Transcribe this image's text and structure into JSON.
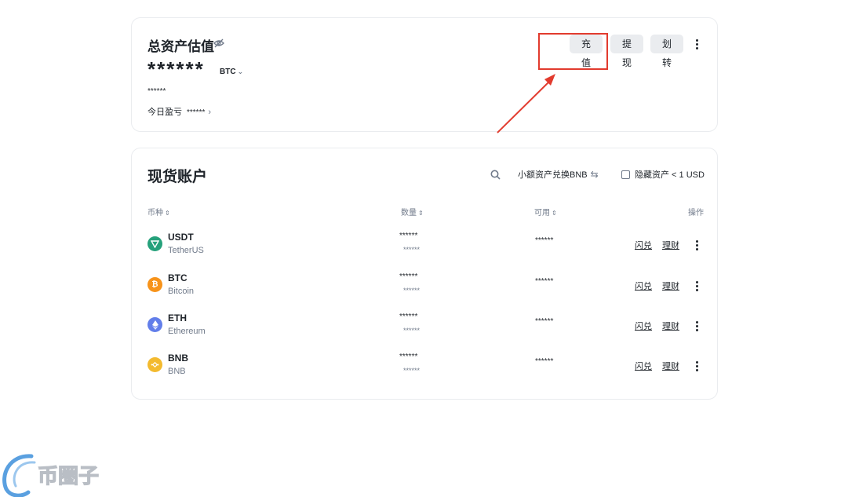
{
  "asset_card": {
    "title": "总资产估值",
    "balance": "******",
    "unit": "BTC",
    "sub_balance": "******",
    "pnl_label": "今日盈亏",
    "pnl_value": "******",
    "buttons": {
      "deposit": "充值",
      "withdraw": "提现",
      "transfer": "划转"
    }
  },
  "spot_card": {
    "title": "现货账户",
    "convert_link": "小额资产兑换BNB",
    "hide_small_label": "隐藏资产 < 1 USD",
    "columns": {
      "coin": "币种",
      "qty": "数量",
      "avail": "可用",
      "action": "操作"
    },
    "rows": [
      {
        "symbol": "USDT",
        "name": "TetherUS",
        "qty": "******",
        "qty_sub": "******",
        "avail": "******",
        "flash": "闪兑",
        "earn": "理财",
        "icon_color": "#26a17b",
        "icon": "usdt-icon"
      },
      {
        "symbol": "BTC",
        "name": "Bitcoin",
        "qty": "******",
        "qty_sub": "******",
        "avail": "******",
        "flash": "闪兑",
        "earn": "理财",
        "icon_color": "#f7931a",
        "icon": "btc-icon"
      },
      {
        "symbol": "ETH",
        "name": "Ethereum",
        "qty": "******",
        "qty_sub": "******",
        "avail": "******",
        "flash": "闪兑",
        "earn": "理财",
        "icon_color": "#627eea",
        "icon": "eth-icon"
      },
      {
        "symbol": "BNB",
        "name": "BNB",
        "qty": "******",
        "qty_sub": "******",
        "avail": "******",
        "flash": "闪兑",
        "earn": "理财",
        "icon_color": "#f3ba2f",
        "icon": "bnb-icon"
      }
    ]
  },
  "watermark": {
    "text": "币圈子"
  },
  "colors": {
    "highlight_red": "#e23b2e",
    "button_bg": "#eaecef",
    "text_primary": "#1e2329",
    "text_secondary": "#707a8a"
  }
}
